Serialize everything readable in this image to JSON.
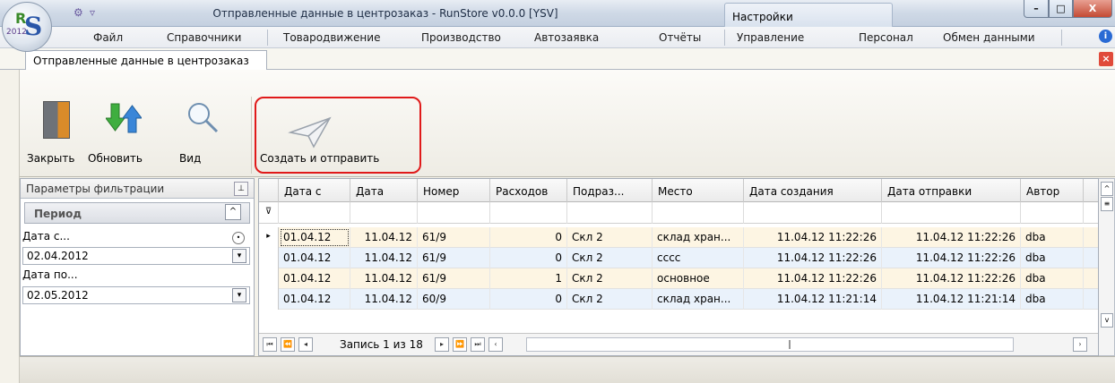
{
  "window": {
    "title": "Отправленные данные в центрозаказ - RunStore v0.0.0 [YSV]",
    "settings_tab": "Настройки",
    "minimize": "–",
    "maximize": "□",
    "close": "X"
  },
  "logo": {
    "year": "2012",
    "letter_r": "R",
    "letter_s": "S"
  },
  "menu": {
    "items": [
      "Файл",
      "Справочники",
      "Товародвижение",
      "Производство",
      "Автозаявка",
      "Отчёты",
      "Управление",
      "Персонал",
      "Обмен данными"
    ],
    "info": "i"
  },
  "doc_tab": {
    "label": "Отправленные данные в центрозаказ",
    "close": "×"
  },
  "toolbar": {
    "close_label": "Закрыть",
    "refresh_label": "Обновить",
    "view_label": "Вид",
    "create_send_label": "Создать и отправить"
  },
  "filter_panel": {
    "header": "Параметры фильтрации",
    "pin": "⊥",
    "group_title": "Период",
    "collapse": "^",
    "date_from_label": "Дата с...",
    "date_from_value": "02.04.2012",
    "date_to_label": "Дата по...",
    "date_to_value": "02.05.2012"
  },
  "grid": {
    "columns": [
      "Дата с",
      "Дата",
      "Номер",
      "Расходов",
      "Подраз...",
      "Место",
      "Дата создания",
      "Дата отправки",
      "Автор"
    ],
    "rows": [
      [
        "01.04.12",
        "11.04.12",
        "61/9",
        "0",
        "Скл 2",
        "склад хран...",
        "11.04.12 11:22:26",
        "11.04.12 11:22:26",
        "dba"
      ],
      [
        "01.04.12",
        "11.04.12",
        "61/9",
        "0",
        "Скл 2",
        "сссс",
        "11.04.12 11:22:26",
        "11.04.12 11:22:26",
        "dba"
      ],
      [
        "01.04.12",
        "11.04.12",
        "61/9",
        "1",
        "Скл 2",
        "основное",
        "11.04.12 11:22:26",
        "11.04.12 11:22:26",
        "dba"
      ],
      [
        "01.04.12",
        "11.04.12",
        "60/9",
        "0",
        "Скл 2",
        "склад хран...",
        "11.04.12 11:21:14",
        "11.04.12 11:21:14",
        "dba"
      ]
    ],
    "row_colors": [
      "#fdf5e3",
      "#eaf2fb",
      "#fdf5e3",
      "#eaf2fb"
    ],
    "record_text": "Запись 1 из 18",
    "filter_icon": "⊽",
    "current_row_marker": "▸"
  },
  "colors": {
    "highlight": "#e01a1a"
  }
}
